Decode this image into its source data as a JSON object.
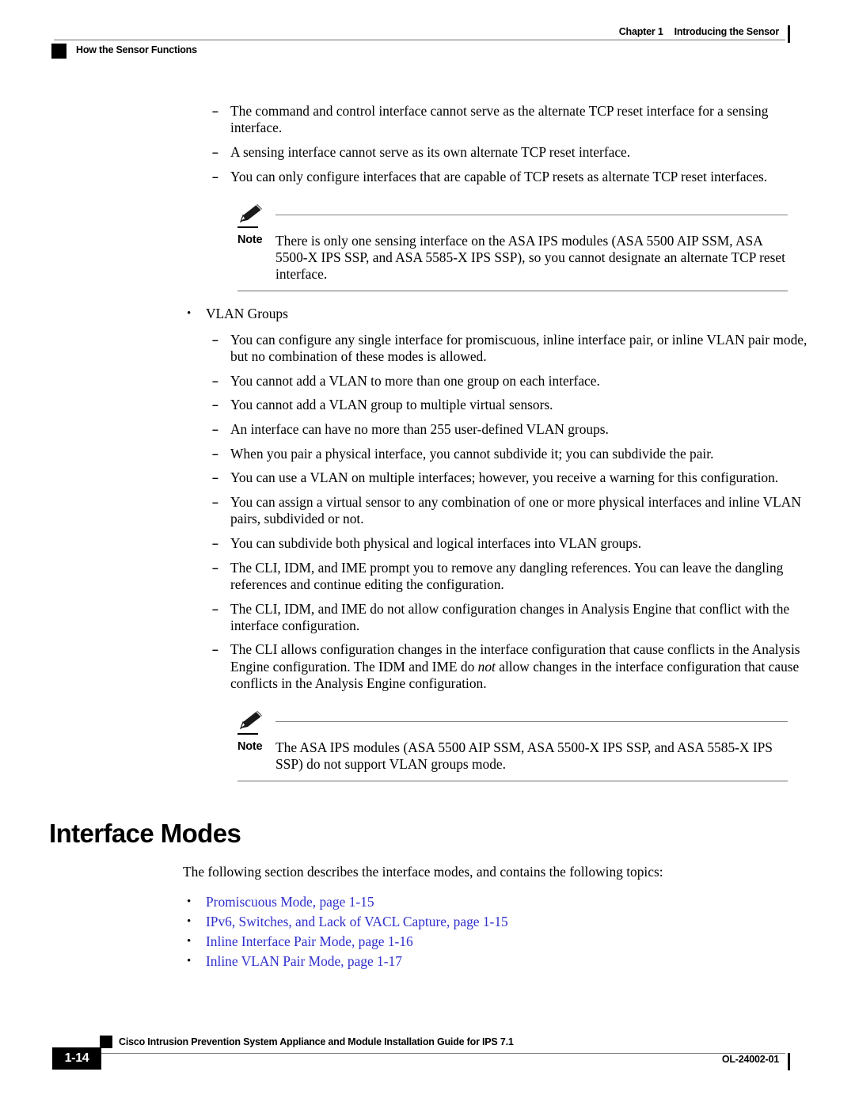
{
  "header": {
    "chapter": "Chapter 1",
    "chapter_title": "Introducing the Sensor",
    "section": "How the Sensor Functions"
  },
  "content": {
    "tcp_reset_bullets": [
      "The command and control interface cannot serve as the alternate TCP reset interface for a sensing interface.",
      "A sensing interface cannot serve as its own alternate TCP reset interface.",
      "You can only configure interfaces that are capable of TCP resets as alternate TCP reset interfaces."
    ],
    "note_1": {
      "label": "Note",
      "text": "There is only one sensing interface on the ASA IPS modules (ASA 5500 AIP SSM, ASA 5500-X IPS SSP, and ASA 5585-X IPS SSP), so you cannot designate an alternate TCP reset interface."
    },
    "vlan_groups_heading": "VLAN Groups",
    "vlan_groups_bullets": [
      "You can configure any single interface for promiscuous, inline interface pair, or inline VLAN pair mode, but no combination of these modes is allowed.",
      "You cannot add a VLAN to more than one group on each interface.",
      "You cannot add a VLAN group to multiple virtual sensors.",
      "An interface can have no more than 255 user-defined VLAN groups.",
      "When you pair a physical interface, you cannot subdivide it; you can subdivide the pair.",
      "You can use a VLAN on multiple interfaces; however, you receive a warning for this configuration.",
      "You can assign a virtual sensor to any combination of one or more physical interfaces and inline VLAN pairs, subdivided or not.",
      "You can subdivide both physical and logical interfaces into VLAN groups.",
      "The CLI, IDM, and IME prompt you to remove any dangling references. You can leave the dangling references and continue editing the configuration.",
      "The CLI, IDM, and IME do not allow configuration changes in Analysis Engine that conflict with the interface configuration."
    ],
    "cli_conflict_bullet": {
      "part1": "The CLI allows configuration changes in the interface configuration that cause conflicts in the Analysis Engine configuration. The IDM and IME do ",
      "emphasis": "not",
      "part2": " allow changes in the interface configuration that cause conflicts in the Analysis Engine configuration."
    },
    "note_2": {
      "label": "Note",
      "text": "The ASA IPS modules (ASA 5500 AIP SSM, ASA 5500-X IPS SSP, and ASA 5585-X IPS SSP) do not support VLAN groups mode."
    },
    "section_title": "Interface Modes",
    "section_intro": "The following section describes the interface modes, and contains the following topics:",
    "topic_links": [
      "Promiscuous Mode, page 1-15",
      "IPv6, Switches, and Lack of VACL Capture, page 1-15",
      "Inline Interface Pair Mode, page 1-16",
      "Inline VLAN Pair Mode, page 1-17"
    ]
  },
  "footer": {
    "guide_title": "Cisco Intrusion Prevention System Appliance and Module Installation Guide for IPS 7.1",
    "page_number": "1-14",
    "doc_id": "OL-24002-01"
  },
  "colors": {
    "link": "#2f2fcc",
    "rule": "#7a7a7a",
    "text": "#000000"
  },
  "icons": {
    "note": "pencil-icon",
    "bullet": "•",
    "dash": "–"
  }
}
